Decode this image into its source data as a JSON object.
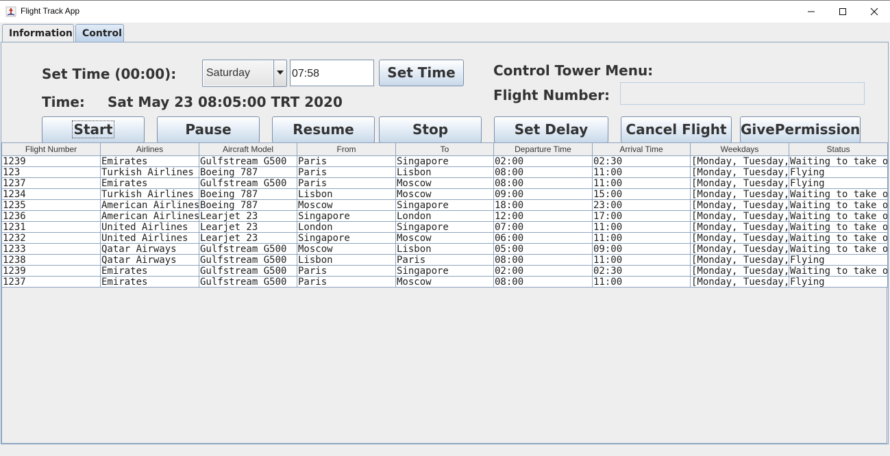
{
  "window": {
    "title": "Flight Track App",
    "controls": [
      "minimize-icon",
      "maximize-icon",
      "close-icon"
    ]
  },
  "tabs": [
    {
      "label": "Information",
      "selected": false
    },
    {
      "label": "Control",
      "selected": true
    }
  ],
  "set_time": {
    "label": "Set Time (00:00):",
    "day_select": {
      "value": "Saturday"
    },
    "time_value": "07:58",
    "button": "Set Time"
  },
  "clock": {
    "label": "Time:",
    "value": "Sat May 23 08:05:00 TRT 2020"
  },
  "tower": {
    "menu_label": "Control Tower Menu:",
    "flight_number_label": "Flight Number:",
    "flight_number_value": ""
  },
  "actions": {
    "start": "Start",
    "pause": "Pause",
    "resume": "Resume",
    "stop": "Stop",
    "set_delay": "Set Delay",
    "cancel_flight": "Cancel Flight",
    "give_permission": "GivePermission"
  },
  "table": {
    "columns": [
      "Flight Number",
      "Airlines",
      "Aircraft Model",
      "From",
      "To",
      "Departure Time",
      "Arrival Time",
      "Weekdays",
      "Status"
    ],
    "rows": [
      [
        "1239",
        "Emirates",
        "Gulfstream G500",
        "Paris",
        "Singapore",
        "02:00",
        "02:30",
        "[Monday, Tuesday,...",
        "Waiting to take off"
      ],
      [
        "123",
        "Turkish Airlines",
        "Boeing 787",
        "Paris",
        "Lisbon",
        "08:00",
        "11:00",
        "[Monday, Tuesday,...",
        "Flying"
      ],
      [
        "1237",
        "Emirates",
        "Gulfstream G500",
        "Paris",
        "Moscow",
        "08:00",
        "11:00",
        "[Monday, Tuesday,...",
        "Flying"
      ],
      [
        "1234",
        "Turkish Airlines",
        "Boeing 787",
        "Lisbon",
        "Moscow",
        "09:00",
        "15:00",
        "[Monday, Tuesday,...",
        "Waiting to take off"
      ],
      [
        "1235",
        "American Airlines",
        "Boeing 787",
        "Moscow",
        "Singapore",
        "18:00",
        "23:00",
        "[Monday, Tuesday,...",
        "Waiting to take off"
      ],
      [
        "1236",
        "American Airlines",
        "Learjet 23",
        "Singapore",
        "London",
        "12:00",
        "17:00",
        "[Monday, Tuesday,...",
        "Waiting to take off"
      ],
      [
        "1231",
        "United Airlines",
        "Learjet 23",
        "London",
        "Singapore",
        "07:00",
        "11:00",
        "[Monday, Tuesday,...",
        "Waiting to take off"
      ],
      [
        "1232",
        "United Airlines",
        "Learjet 23",
        "Singapore",
        "Moscow",
        "06:00",
        "11:00",
        "[Monday, Tuesday,...",
        "Waiting to take off"
      ],
      [
        "1233",
        "Qatar Airways",
        "Gulfstream G500",
        "Moscow",
        "Lisbon",
        "05:00",
        "09:00",
        "[Monday, Tuesday,...",
        "Waiting to take off"
      ],
      [
        "1238",
        "Qatar Airways",
        "Gulfstream G500",
        "Lisbon",
        "Paris",
        "08:00",
        "11:00",
        "[Monday, Tuesday,...",
        "Flying"
      ],
      [
        "1239",
        "Emirates",
        "Gulfstream G500",
        "Paris",
        "Singapore",
        "02:00",
        "02:30",
        "[Monday, Tuesday,...",
        "Waiting to take off"
      ],
      [
        "1237",
        "Emirates",
        "Gulfstream G500",
        "Paris",
        "Moscow",
        "08:00",
        "11:00",
        "[Monday, Tuesday,...",
        "Flying"
      ]
    ]
  }
}
